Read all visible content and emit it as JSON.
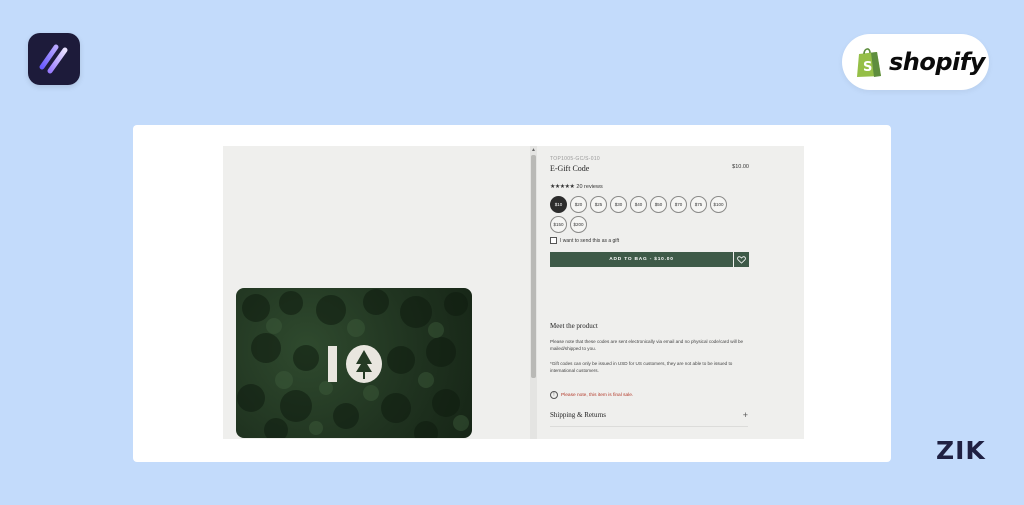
{
  "branding": {
    "app_logo_icon": "app-logo-slashes-icon",
    "shopify_wordmark": "shopify",
    "corner_mark": "ZIK",
    "colors": {
      "background": "#c3dbfb",
      "app_logo_bg": "#1d1b3a",
      "shopify_green": "#95bf47",
      "button_green": "#3e5a48"
    }
  },
  "product": {
    "sku": "TOP1005-GC/S-010",
    "title": "E-Gift Code",
    "price": "$10.00",
    "rating": {
      "stars": "★★★★★",
      "reviews": "20 reviews"
    },
    "amounts": [
      {
        "label": "$10",
        "selected": true
      },
      {
        "label": "$20",
        "selected": false
      },
      {
        "label": "$25",
        "selected": false
      },
      {
        "label": "$30",
        "selected": false
      },
      {
        "label": "$40",
        "selected": false
      },
      {
        "label": "$50",
        "selected": false
      },
      {
        "label": "$70",
        "selected": false
      },
      {
        "label": "$75",
        "selected": false
      },
      {
        "label": "$100",
        "selected": false
      },
      {
        "label": "$150",
        "selected": false
      },
      {
        "label": "$200",
        "selected": false
      }
    ],
    "gift_checkbox_label": "I want to send this as a gift",
    "add_to_bag_label": "ADD TO BAG - $10.00",
    "wishlist_icon": "heart-icon"
  },
  "details": {
    "heading": "Meet the product",
    "description": "Please note that these codes are sent electronically via email and no physical code/card will be mailed/shipped to you.",
    "note": "*Gift codes can only be issued in USD for US customers, they are not able to be issued to international customers.",
    "final_sale": "Please note, this item is final sale.",
    "shipping_label": "Shipping & Returns",
    "shipping_toggle": "+"
  }
}
